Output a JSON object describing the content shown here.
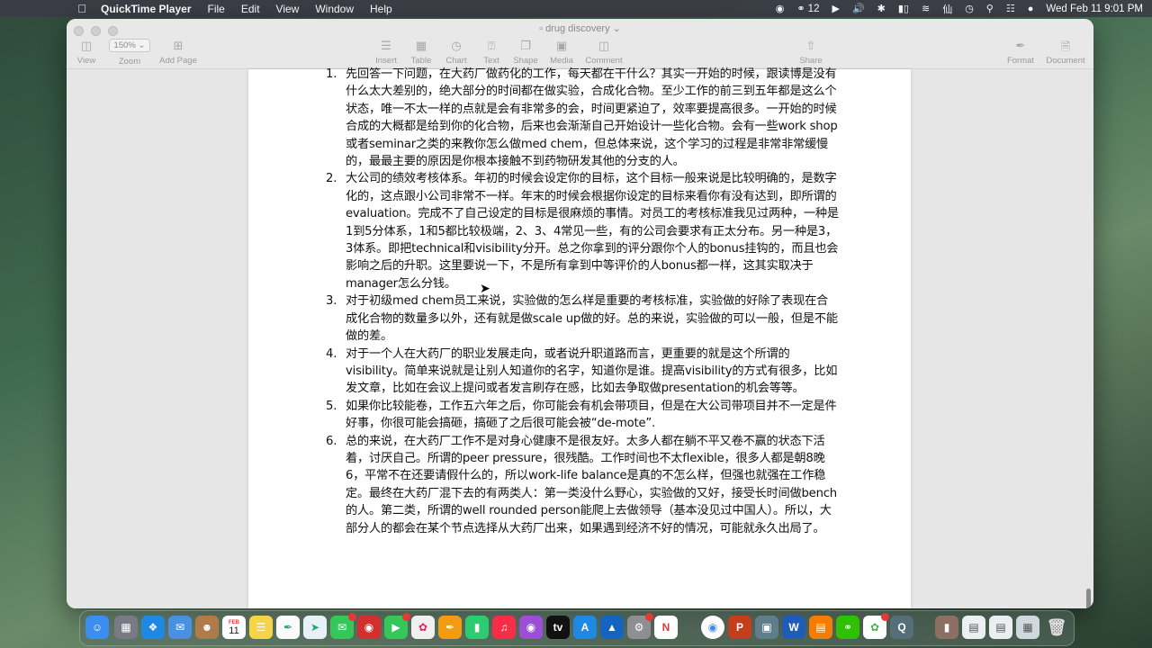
{
  "menubar": {
    "app_name": "QuickTime Player",
    "menus": [
      "File",
      "Edit",
      "View",
      "Window",
      "Help"
    ],
    "wechat_count": "12",
    "datetime": "Wed Feb 11  9:01 PM"
  },
  "window": {
    "title": "drug discovery",
    "toolbar": {
      "view": "View",
      "zoom_value": "150%",
      "zoom": "Zoom",
      "add_page": "Add Page",
      "insert": "Insert",
      "table": "Table",
      "chart": "Chart",
      "text": "Text",
      "shape": "Shape",
      "media": "Media",
      "comment": "Comment",
      "share": "Share",
      "format": "Format",
      "document": "Document"
    }
  },
  "document": {
    "items": [
      {
        "num": "1.",
        "text": "先回答一下问题，在大药厂做药化的工作，每天都在干什么？其实一开始的时候，跟读博是没有什么太大差别的，绝大部分的时间都在做实验，合成化合物。至少工作的前三到五年都是这么个状态，唯一不太一样的点就是会有非常多的会，时间更紧迫了，效率要提高很多。一开始的时候合成的大概都是给到你的化合物，后来也会渐渐自己开始设计一些化合物。会有一些work shop或者seminar之类的来教你怎么做med chem，但总体来说，这个学习的过程是非常非常缓慢的，最最主要的原因是你根本接触不到药物研发其他的分支的人。"
      },
      {
        "num": "2.",
        "text": "大公司的绩效考核体系。年初的时候会设定你的目标，这个目标一般来说是比较明确的，是数字化的，这点跟小公司非常不一样。年末的时候会根据你设定的目标来看你有没有达到，即所谓的evaluation。完成不了自己设定的目标是很麻烦的事情。对员工的考核标准我见过两种，一种是1到5分体系，1和5都比较极端，2、3、4常见一些，有的公司会要求有正太分布。另一种是3，3体系。即把technical和visibility分开。总之你拿到的评分跟你个人的bonus挂钩的，而且也会影响之后的升职。这里要说一下，不是所有拿到中等评价的人bonus都一样，这其实取决于manager怎么分钱。"
      },
      {
        "num": "3.",
        "text": "对于初级med chem员工来说，实验做的怎么样是重要的考核标准，实验做的好除了表现在合成化合物的数量多以外，还有就是做scale up做的好。总的来说，实验做的可以一般，但是不能做的差。"
      },
      {
        "num": "4.",
        "text": "对于一个人在大药厂的职业发展走向，或者说升职道路而言，更重要的就是这个所谓的visibility。简单来说就是让别人知道你的名字，知道你是谁。提高visibility的方式有很多，比如发文章，比如在会议上提问或者发言刷存在感，比如去争取做presentation的机会等等。"
      },
      {
        "num": "5.",
        "text": "如果你比较能卷，工作五六年之后，你可能会有机会带项目，但是在大公司带项目并不一定是件好事，你很可能会搞砸，搞砸了之后很可能会被“de-mote”."
      },
      {
        "num": "6.",
        "text": "总的来说，在大药厂工作不是对身心健康不是很友好。太多人都在躺不平又卷不赢的状态下活着，讨厌自己。所谓的peer pressure，很残酷。工作时间也不太flexible，很多人都是朝8晚6，平常不在还要请假什么的，所以work-life balance是真的不怎么样，但强也就强在工作稳定。最终在大药厂混下去的有两类人：第一类没什么野心，实验做的又好，接受长时间做bench的人。第二类，所谓的well rounded person能爬上去做领导（基本没见过中国人）。所以，大部分人的都会在某个节点选择从大药厂出来，如果遇到经济不好的情况，可能就永久出局了。"
      }
    ]
  },
  "dock": {
    "calendar_month": "FEB",
    "calendar_day": "11"
  }
}
